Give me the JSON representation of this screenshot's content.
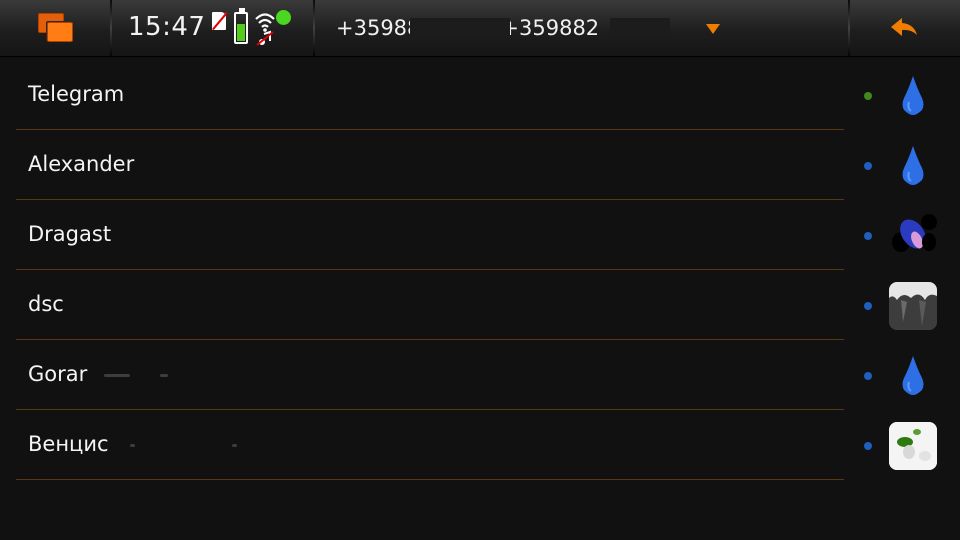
{
  "statusbar": {
    "time": "15:47",
    "battery_level": 0.6,
    "presence_color": "#4bd61f"
  },
  "account": {
    "selector_text": "+35988          - +359882",
    "icon": "chevron-down-icon",
    "accent": "#f07d00"
  },
  "nav": {
    "task_switcher_icon": "task-switcher-icon",
    "back_icon": "back-arrow-icon"
  },
  "contacts": [
    {
      "name": "Telegram",
      "status_color": "#3f8a1a",
      "avatar": "default"
    },
    {
      "name": "Alexander",
      "status_color": "#1e5fc0",
      "avatar": "default"
    },
    {
      "name": "Dragast",
      "status_color": "#1e5fc0",
      "avatar": "photo"
    },
    {
      "name": "dsc",
      "status_color": "#1e5fc0",
      "avatar": "photo"
    },
    {
      "name": "Gorar",
      "status_color": "#1e5fc0",
      "avatar": "default"
    },
    {
      "name": "Венцис",
      "status_color": "#1e5fc0",
      "avatar": "photo"
    }
  ]
}
